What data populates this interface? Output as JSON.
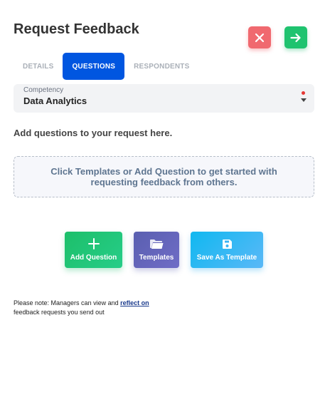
{
  "header": {
    "title": "Request Feedback",
    "close_icon": "close-icon",
    "next_icon": "arrow-right-icon"
  },
  "tabs": [
    {
      "label": "DETAILS",
      "active": false
    },
    {
      "label": "QUESTIONS",
      "active": true
    },
    {
      "label": "RESPONDENTS",
      "active": false
    }
  ],
  "competency": {
    "label": "Competency",
    "value": "Data Analytics"
  },
  "instructions": "Add questions to your request here.",
  "empty_state": "Click Templates or Add Question to get started with requesting feedback from others.",
  "actions": {
    "add_question": {
      "label": "Add Question",
      "icon": "plus-icon"
    },
    "templates": {
      "label": "Templates",
      "icon": "folder-icon"
    },
    "save_template": {
      "label": "Save As Template",
      "icon": "save-icon"
    }
  },
  "note": {
    "prefix": "Please note: Managers can view and ",
    "link": "reflect on",
    "suffix": "feedback requests you send out"
  },
  "colors": {
    "accent": "#0056e0",
    "close": "#f0696f",
    "next": "#1fc36f",
    "add_question": "#1dbf6a",
    "templates": "#5a5fb0",
    "save_template": "#10b8f0"
  }
}
